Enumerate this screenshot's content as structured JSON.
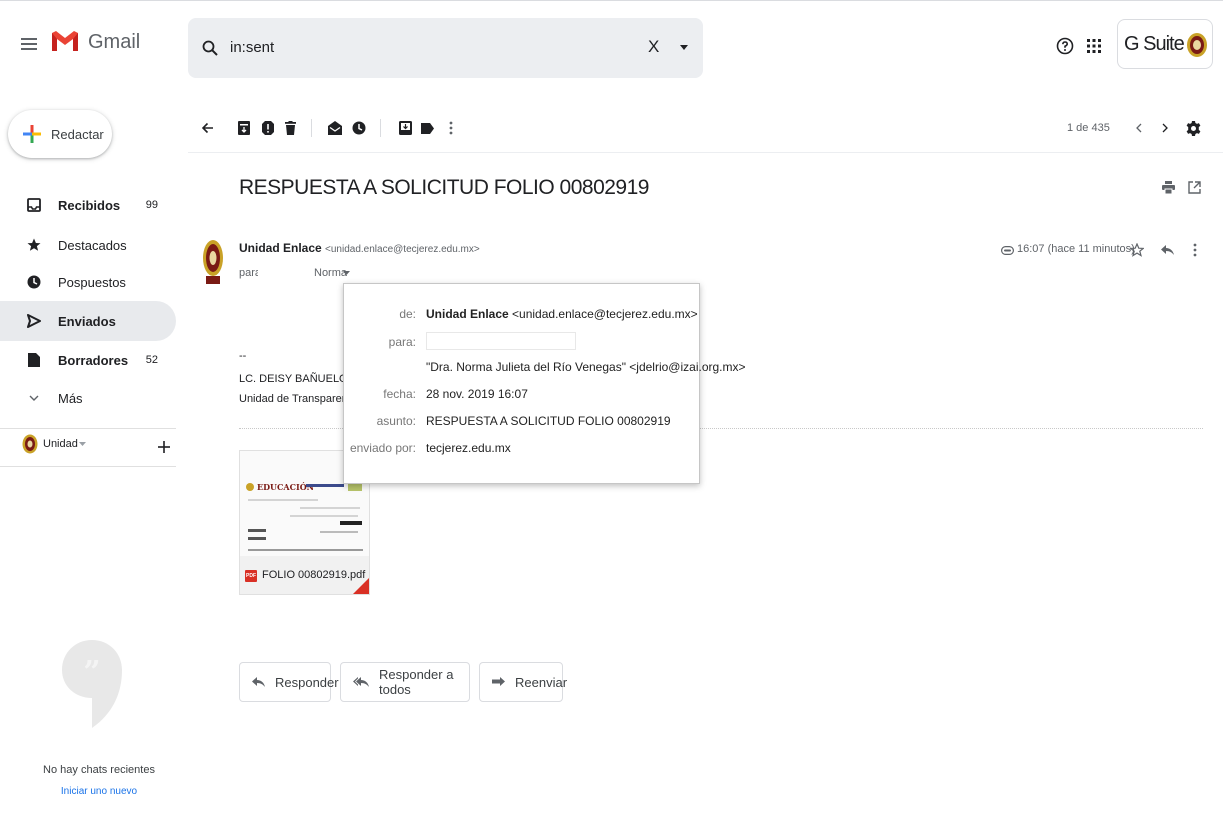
{
  "app": {
    "logo_text": "Gmail",
    "suite_text": "G Suite"
  },
  "search": {
    "value": "in:sent",
    "clear_label": "X"
  },
  "compose": {
    "label": "Redactar"
  },
  "sidebar": {
    "items": [
      {
        "label": "Recibidos",
        "count": "99",
        "icon": "inbox-icon"
      },
      {
        "label": "Destacados",
        "count": "",
        "icon": "star-icon"
      },
      {
        "label": "Pospuestos",
        "count": "",
        "icon": "clock-icon"
      },
      {
        "label": "Enviados",
        "count": "",
        "icon": "send-icon"
      },
      {
        "label": "Borradores",
        "count": "52",
        "icon": "draft-icon"
      },
      {
        "label": "Más",
        "count": "",
        "icon": "chevron-down-icon"
      }
    ],
    "account_label": "Unidad",
    "hangouts_empty": "No hay chats recientes",
    "hangouts_start": "Iniciar uno nuevo"
  },
  "toolbar": {
    "pagination": "1 de 435"
  },
  "message": {
    "subject": "RESPUESTA A SOLICITUD FOLIO 00802919",
    "sender_name": "Unidad Enlace",
    "sender_email": "<unidad.enlace@tecjerez.edu.mx>",
    "to_prefix": "para",
    "to_name": "Norma",
    "time": "16:07 (hace 11 minutos)",
    "signature_dash": "--",
    "signature_name": "LC. DEISY BAÑUELOS F",
    "signature_unit": "Unidad de Transparencia",
    "attachment_name": "FOLIO 00802919.pdf",
    "attachment_header": "EDUCACIÓN"
  },
  "details": {
    "de_label": "de:",
    "de_name": "Unidad Enlace",
    "de_email": "<unidad.enlace@tecjerez.edu.mx>",
    "para_label": "para:",
    "para_value2": "\"Dra. Norma Julieta del Río Venegas\" <jdelrio@izai.org.mx>",
    "fecha_label": "fecha:",
    "fecha_value": "28 nov. 2019 16:07",
    "asunto_label": "asunto:",
    "asunto_value": "RESPUESTA A SOLICITUD FOLIO 00802919",
    "enviado_label": "enviado por:",
    "enviado_value": "tecjerez.edu.mx"
  },
  "actions": {
    "reply": "Responder",
    "reply_all": "Responder a todos",
    "forward": "Reenviar"
  }
}
